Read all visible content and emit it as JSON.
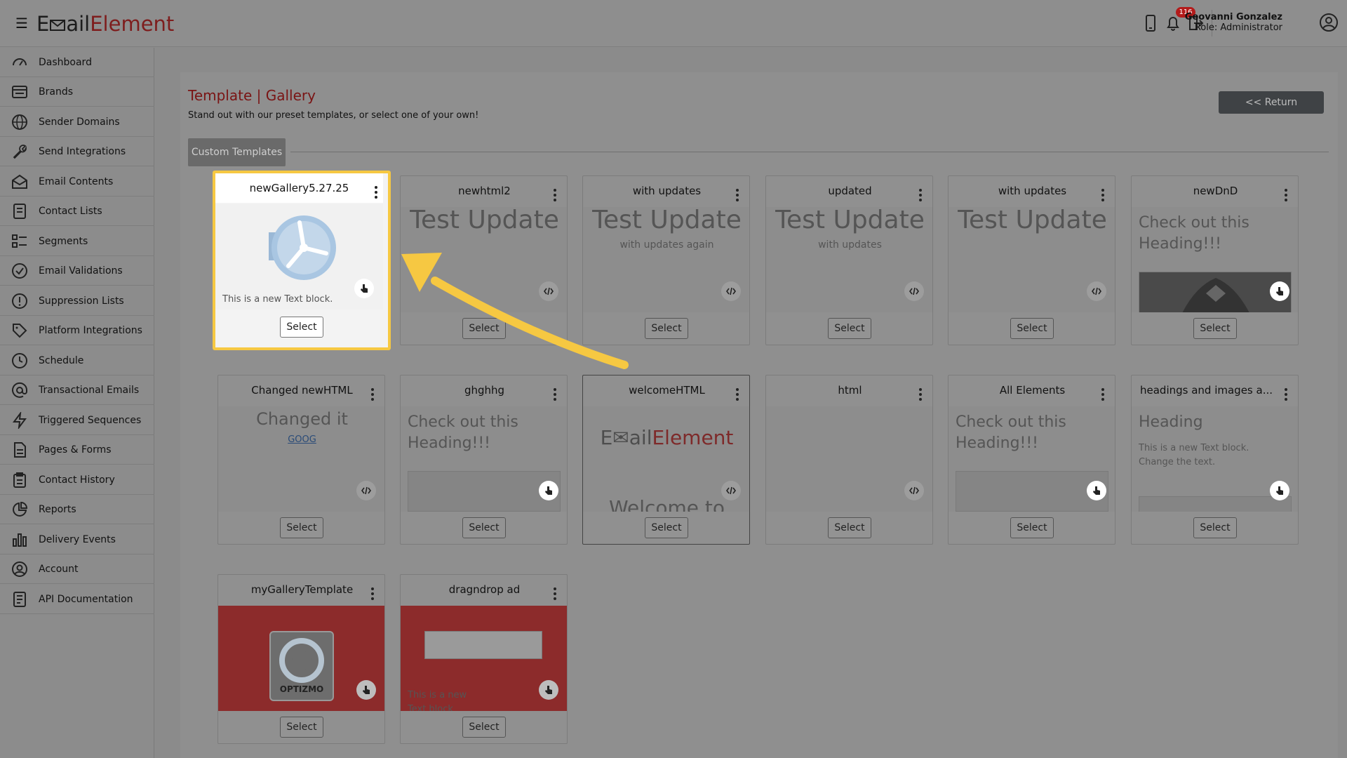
{
  "header": {
    "logo_prefix": "E",
    "logo_mid": "ail",
    "logo_suffix": "Element",
    "notification_count": "116",
    "user_name": "Geovanni Gonzalez",
    "user_role": "Role: Administrator"
  },
  "sidebar": {
    "items": [
      {
        "label": "Dashboard"
      },
      {
        "label": "Brands"
      },
      {
        "label": "Sender Domains"
      },
      {
        "label": "Send Integrations"
      },
      {
        "label": "Email Contents"
      },
      {
        "label": "Contact Lists"
      },
      {
        "label": "Segments"
      },
      {
        "label": "Email Validations"
      },
      {
        "label": "Suppression Lists"
      },
      {
        "label": "Platform Integrations"
      },
      {
        "label": "Schedule"
      },
      {
        "label": "Transactional Emails"
      },
      {
        "label": "Triggered Sequences"
      },
      {
        "label": "Pages & Forms"
      },
      {
        "label": "Contact History"
      },
      {
        "label": "Reports"
      },
      {
        "label": "Delivery Events"
      },
      {
        "label": "Account"
      },
      {
        "label": "API Documentation"
      }
    ]
  },
  "page": {
    "title": "Template | Gallery",
    "subtitle": "Stand out with our preset templates, or select one of your own!",
    "return_label": "<< Return",
    "tab_label": "Custom Templates",
    "select_label": "Select"
  },
  "cards": [
    {
      "title": "newGallery5.27.25",
      "text": "This is a new Text block."
    },
    {
      "title": "newhtml2",
      "big": "Test Update"
    },
    {
      "title": "with updates",
      "big": "Test Update",
      "small": "with updates again"
    },
    {
      "title": "updated",
      "big": "Test Update",
      "small": "with updates"
    },
    {
      "title": "with updates",
      "big": "Test Update"
    },
    {
      "title": "newDnD",
      "heading": "Check out this Heading!!!"
    },
    {
      "title": "Changed newHTML",
      "big": "Changed it",
      "link": "GOOG"
    },
    {
      "title": "ghghhg",
      "heading": "Check out this Heading!!!"
    },
    {
      "title": "welcomeHTML",
      "logo_prefix": "E",
      "logo_mid": "ail",
      "logo_suffix": "Element",
      "welcome": "Welcome to"
    },
    {
      "title": "html"
    },
    {
      "title": "All Elements",
      "heading": "Check out this Heading!!!"
    },
    {
      "title": "headings and images a...",
      "heading": "Heading",
      "text": "This is a new Text block. Change the text."
    },
    {
      "title": "myGalleryTemplate",
      "logo_text": "OPTIZMO"
    },
    {
      "title": "dragndrop ad",
      "text": "This is a new Text block"
    }
  ],
  "colors": {
    "accent_highlight": "#f6c842",
    "title_red": "#7a1414",
    "return_button": "#3f4245",
    "badge": "#b31b1b"
  }
}
